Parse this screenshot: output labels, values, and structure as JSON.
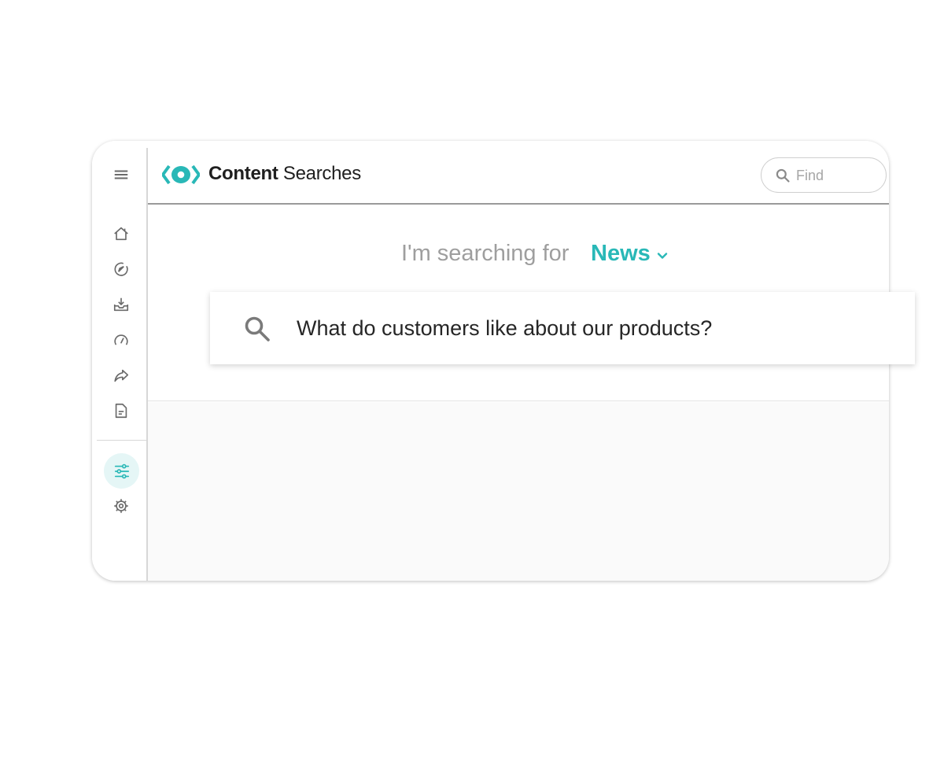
{
  "header": {
    "title_strong": "Content",
    "title_light": "Searches",
    "find_placeholder": "Find"
  },
  "search": {
    "prompt": "I'm searching for",
    "category": "News",
    "query": "What do customers like about our products?"
  },
  "sidebar": {
    "items": [
      "menu-icon",
      "home-icon",
      "compass-icon",
      "inbox-download-icon",
      "speedometer-icon",
      "share-arrow-icon",
      "document-icon",
      "filter-sliders-icon",
      "settings-gear-icon"
    ],
    "active_item": "filter-sliders-icon"
  },
  "colors": {
    "accent": "#29b8b7",
    "active_bg": "#e5f6f6",
    "icon_gray": "#6a6a6a",
    "prompt_gray": "#9e9e9e"
  }
}
